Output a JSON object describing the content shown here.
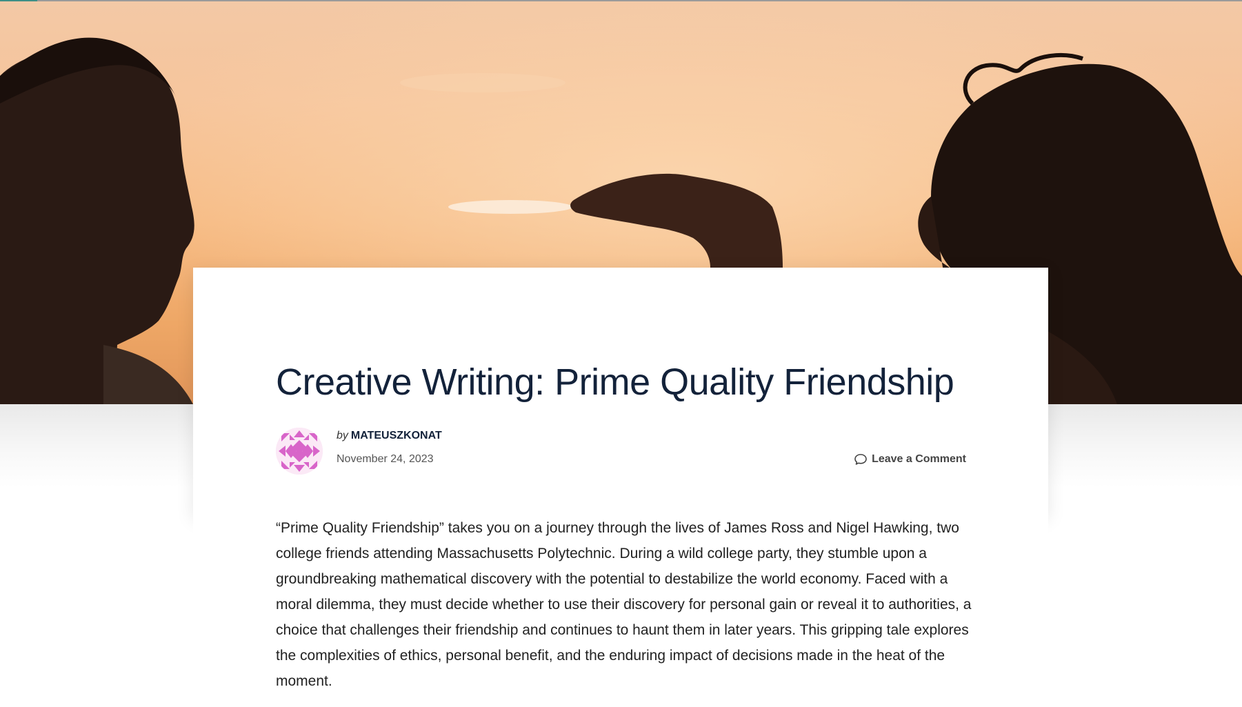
{
  "hero": {
    "image_alt": "Silhouettes of two people at sunset with a raised hand"
  },
  "post": {
    "title": "Creative Writing: Prime Quality Friendship",
    "by_label": "by",
    "author": "MATEUSZKONAT",
    "date": "November 24, 2023",
    "comment_link": "Leave a Comment",
    "comment_icon": "speech-bubble-icon",
    "excerpt": "“Prime Quality Friendship” takes you on a journey through the lives of James Ross and Nigel Hawking, two college friends attending Massachusetts Polytechnic. During a wild college party, they stumble upon a groundbreaking mathematical discovery with the potential to destabilize the world economy. Faced with a moral dilemma, they must decide whether to use their discovery for personal gain or reveal it to authorities, a choice that challenges their friendship and continues to haunt them in later years. This gripping tale explores the complexities of ethics, personal benefit, and the enduring impact of decisions made in the heat of the moment."
  },
  "colors": {
    "title": "#13223a",
    "avatar_pink": "#d865c9",
    "accent_teal": "#3f8f86"
  }
}
